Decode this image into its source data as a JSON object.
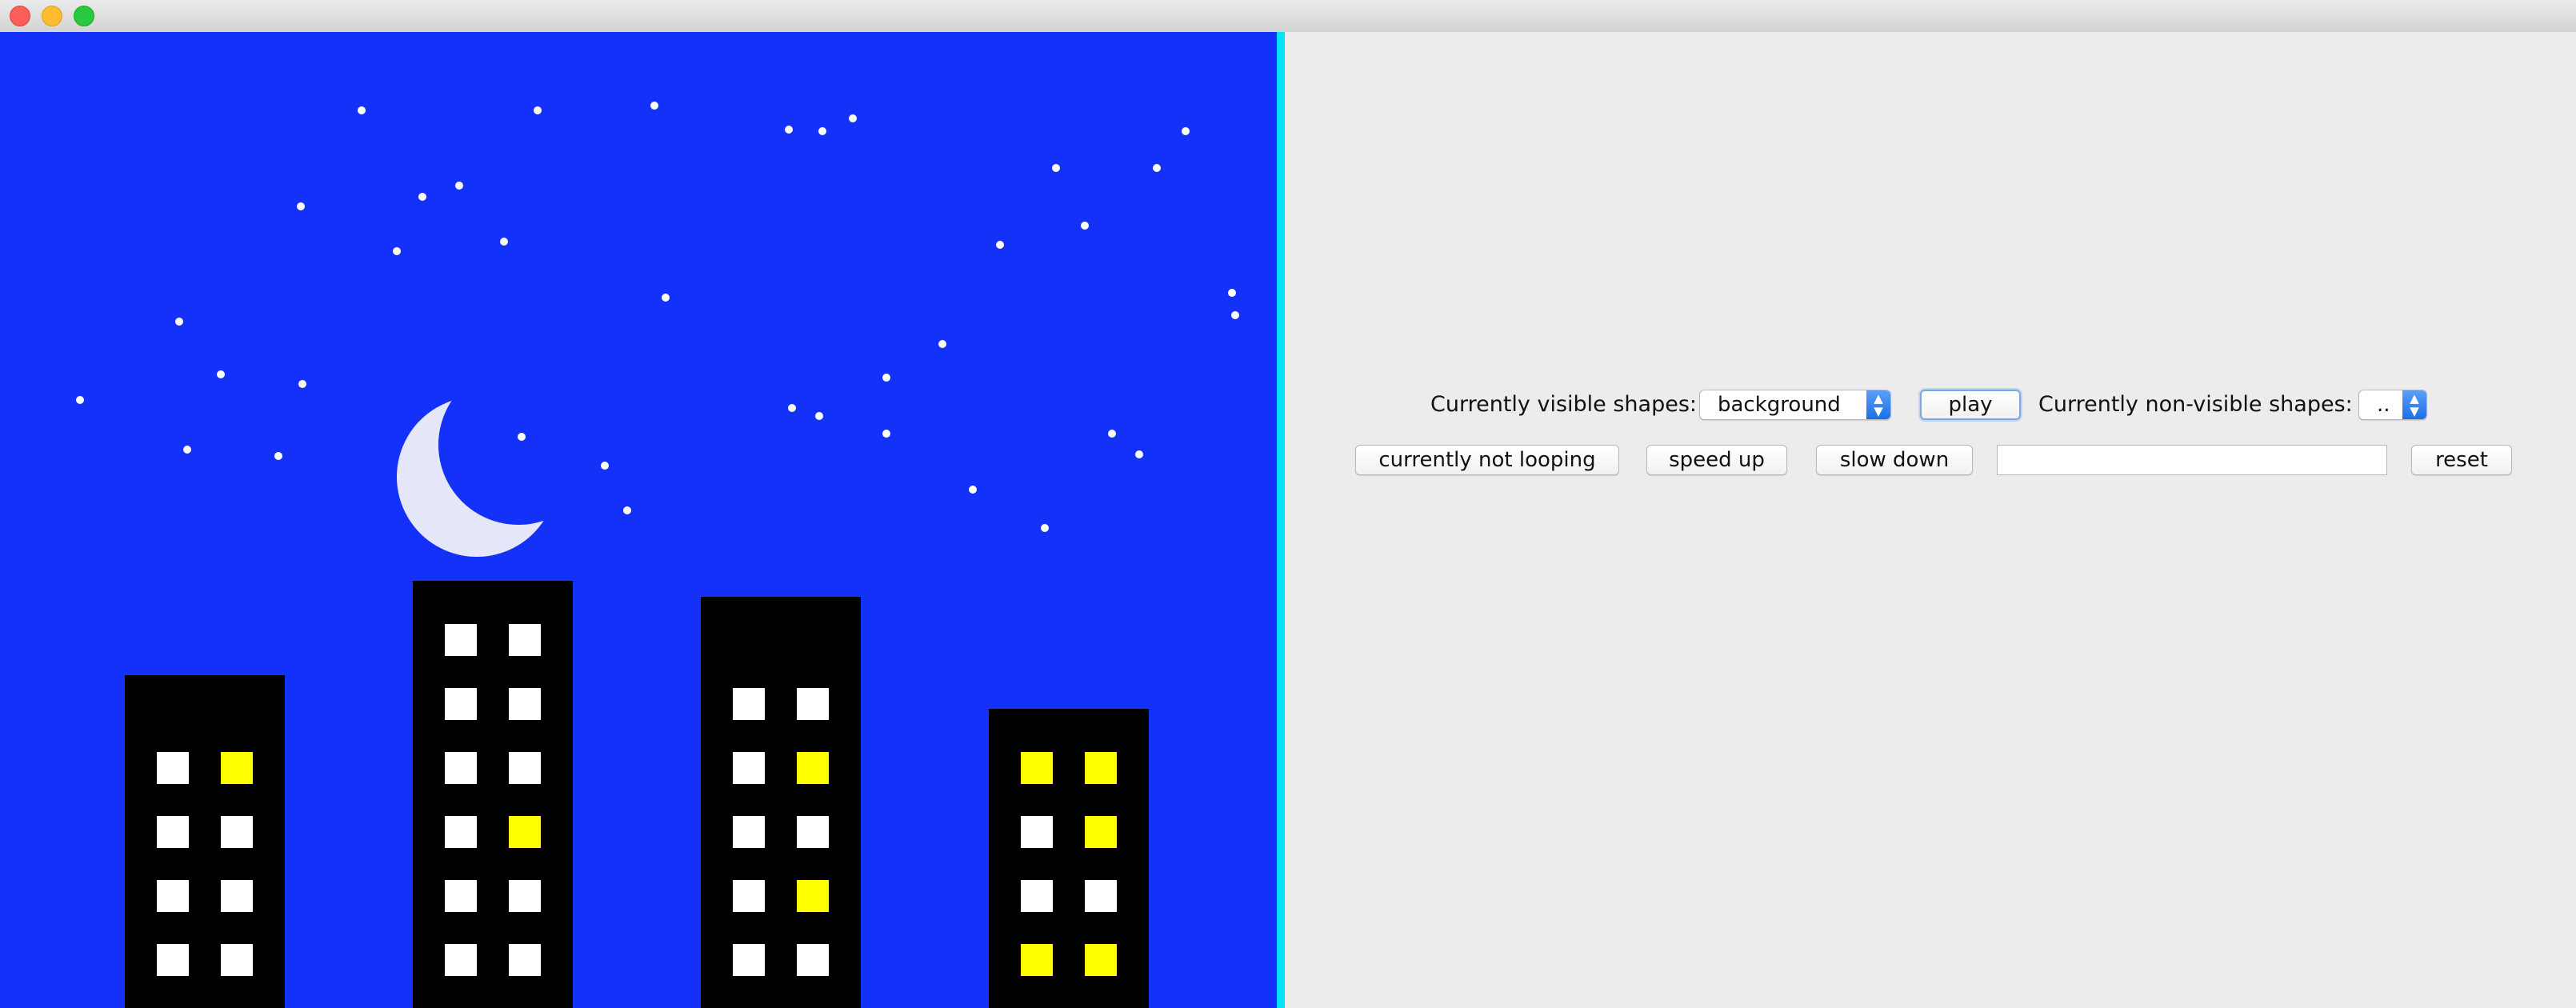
{
  "colors": {
    "sky": "#1431fa",
    "star": "#ffffff",
    "moon": "#e6e6fa",
    "building": "#000000",
    "window_white": "#ffffff",
    "window_yellow": "#ffff00",
    "panel_bg": "#ececec",
    "scroll_edge": "#00e5ff"
  },
  "window_controls": {
    "close_icon": "close-icon",
    "minimize_icon": "minimize-icon",
    "zoom_icon": "zoom-icon"
  },
  "controls": {
    "visible_label": "Currently visible shapes:",
    "visible_select_value": "background",
    "play_label": "play",
    "nonvisible_label": "Currently non-visible shapes:",
    "nonvisible_select_value": "..",
    "loop_label": "currently not looping",
    "speed_up_label": "speed up",
    "slow_down_label": "slow down",
    "text_value": "",
    "reset_label": "reset"
  },
  "scene": {
    "buildings": [
      {
        "windows": [
          "white",
          "yellow",
          "white",
          "white",
          "white",
          "white",
          "white",
          "white",
          "white",
          "yellow"
        ]
      },
      {
        "windows": [
          "white",
          "white",
          "white",
          "white",
          "white",
          "white",
          "white",
          "yellow",
          "white",
          "white",
          "white",
          "white",
          "white",
          "white"
        ]
      },
      {
        "windows": [
          "white",
          "white",
          "white",
          "yellow",
          "white",
          "white",
          "white",
          "yellow",
          "white",
          "white",
          "white",
          "white"
        ]
      },
      {
        "windows": [
          "yellow",
          "yellow",
          "white",
          "yellow",
          "white",
          "white",
          "yellow",
          "yellow",
          "white",
          "white"
        ]
      }
    ]
  }
}
